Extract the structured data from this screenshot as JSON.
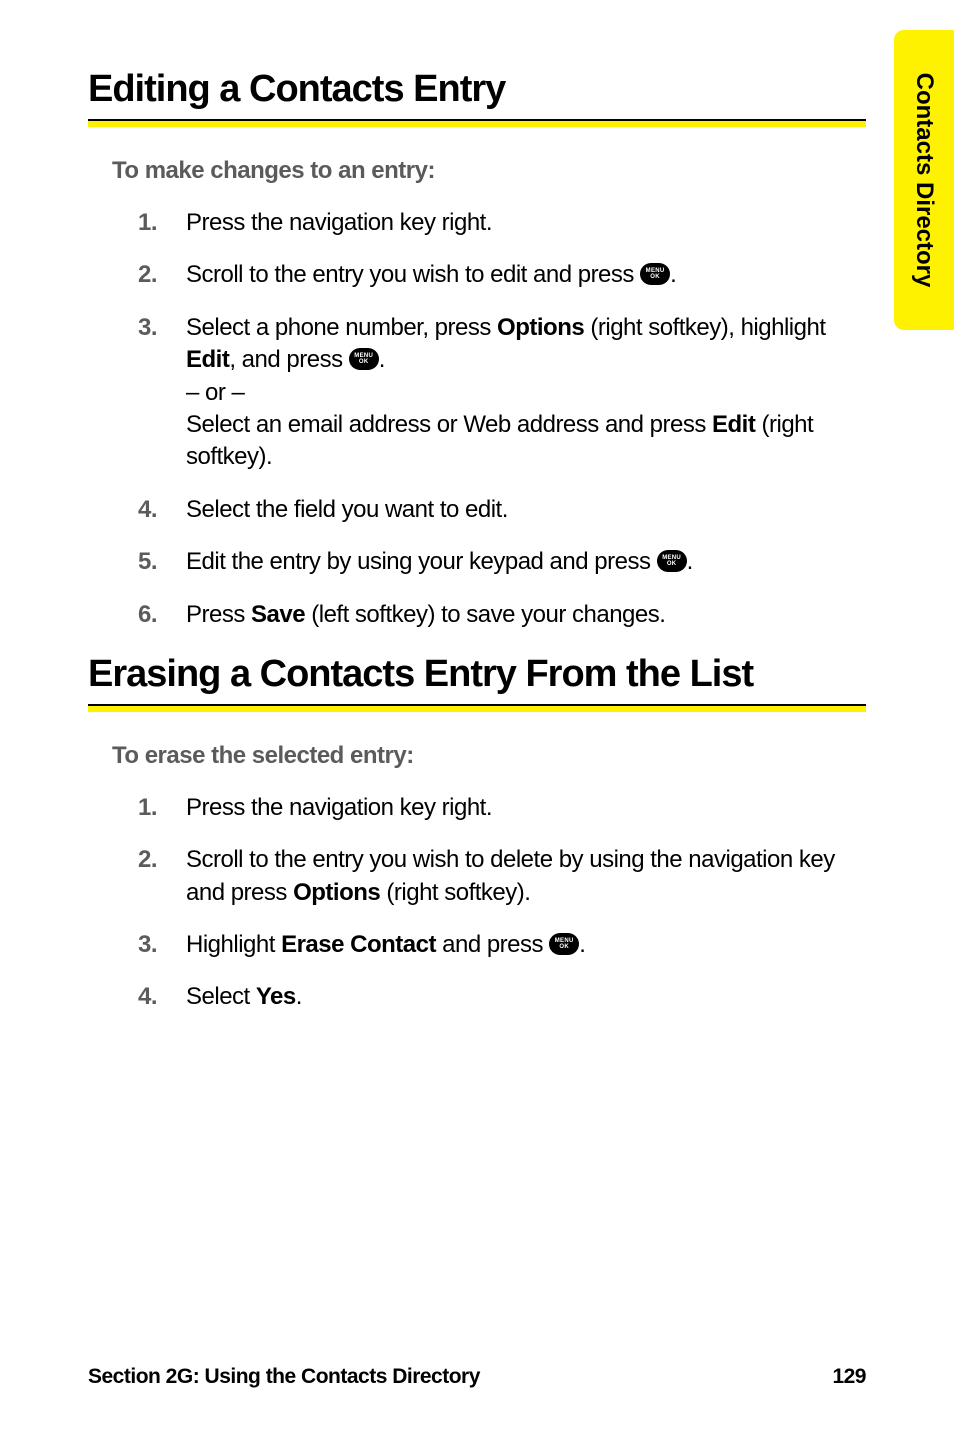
{
  "side_tab": "Contacts Directory",
  "h1_edit": "Editing a Contacts Entry",
  "lead_edit": "To make changes to an entry:",
  "edit_steps": {
    "s1": {
      "num": "1.",
      "a": "Press the navigation key right."
    },
    "s2": {
      "num": "2.",
      "a": "Scroll to the entry you wish to edit and press ",
      "b": "."
    },
    "s3": {
      "num": "3.",
      "a": "Select a phone number, press ",
      "opt": "Options",
      "b": " (right softkey), highlight ",
      "edit_lbl": "Edit",
      "c": ", and press ",
      "d": ".",
      "or": "– or –",
      "e": "Select an email address or Web address and press ",
      "edit_lbl2": "Edit",
      "f": " (right softkey)."
    },
    "s4": {
      "num": "4.",
      "a": "Select the field you want to edit."
    },
    "s5": {
      "num": "5.",
      "a": "Edit the entry by using your keypad and press ",
      "b": "."
    },
    "s6": {
      "num": "6.",
      "a": "Press ",
      "save": "Save",
      "b": " (left softkey) to save your changes."
    }
  },
  "h1_erase": "Erasing a Contacts Entry From the List",
  "lead_erase": "To erase the selected entry:",
  "erase_steps": {
    "s1": {
      "num": "1.",
      "a": "Press the navigation key right."
    },
    "s2": {
      "num": "2.",
      "a": "Scroll to the entry you wish to delete by using the navigation key and press ",
      "opt": "Options",
      "b": " (right softkey)."
    },
    "s3": {
      "num": "3.",
      "a": "Highlight ",
      "ec": "Erase Contact",
      "b": " and press ",
      "c": "."
    },
    "s4": {
      "num": "4.",
      "a": "Select ",
      "yes": "Yes",
      "b": "."
    }
  },
  "footer_left": "Section 2G: Using the Contacts Directory",
  "footer_right": "129",
  "icon": {
    "l1": "MENU",
    "l2": "OK"
  }
}
